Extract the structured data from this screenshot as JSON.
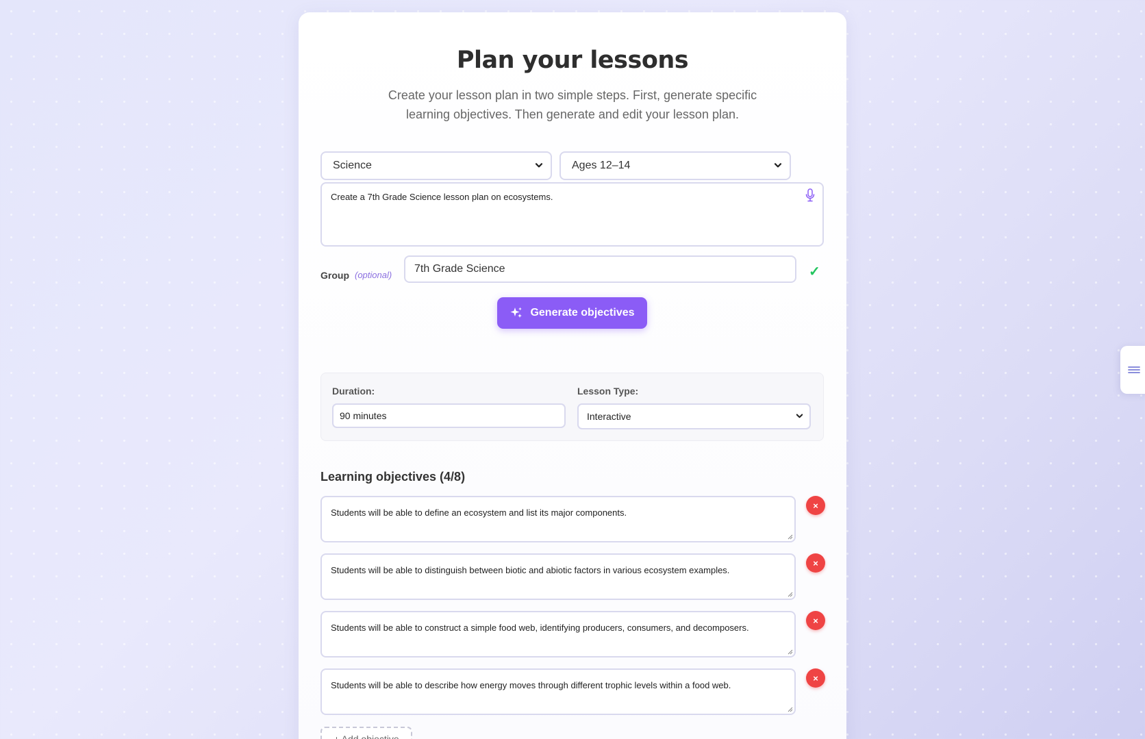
{
  "header": {
    "title": "Plan your lessons",
    "subtitle": "Create your lesson plan in two simple steps. First, generate specific learning objectives. Then generate and edit your lesson plan."
  },
  "subject_select": {
    "value": "Science"
  },
  "age_select": {
    "value": "Ages 12–14"
  },
  "prompt": {
    "value": "Create a 7th Grade Science lesson plan on ecosystems.",
    "mic_icon": "microphone-icon"
  },
  "group": {
    "label": "Group",
    "optional": "(optional)",
    "value": "7th Grade Science",
    "status_icon": "✓"
  },
  "generate_button": {
    "label": "Generate objectives",
    "icon": "sparkles-icon"
  },
  "settings": {
    "duration_label": "Duration:",
    "duration_value": "90 minutes",
    "lesson_type_label": "Lesson Type:",
    "lesson_type_value": "Interactive"
  },
  "objectives": {
    "heading": "Learning objectives (4/8)",
    "items": [
      "Students will be able to define an ecosystem and list its major components.",
      "Students will be able to distinguish between biotic and abiotic factors in various ecosystem examples.",
      "Students will be able to construct a simple food web, identifying producers, consumers, and decomposers.",
      "Students will be able to describe how energy moves through different trophic levels within a food web."
    ],
    "delete_symbol": "×",
    "add_label": "+ Add objective"
  },
  "side_tab": {
    "icon": "menu-icon"
  },
  "colors": {
    "accent": "#8b5cf6",
    "danger": "#ef4444",
    "success": "#22c55e"
  }
}
